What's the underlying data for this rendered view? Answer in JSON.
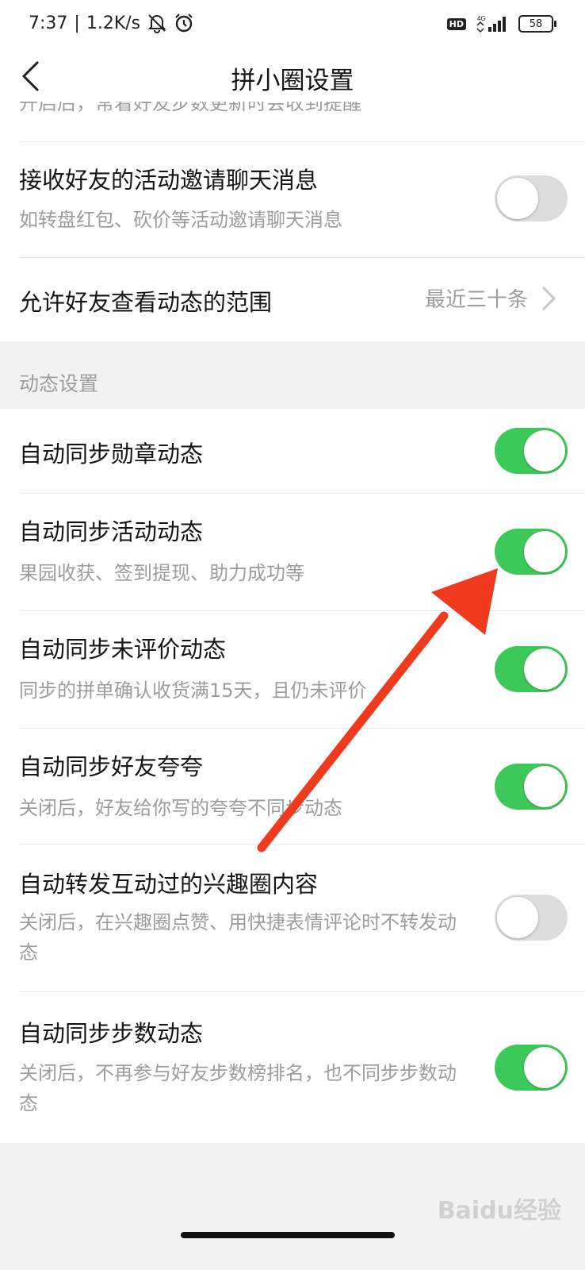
{
  "status_bar": {
    "time": "7:37",
    "speed": "1.2K/s",
    "network": "4G",
    "battery": "58",
    "icons": [
      "mute-bell-icon",
      "alarm-icon",
      "hd-icon",
      "signal-icon",
      "battery-icon"
    ]
  },
  "header": {
    "title": "拼小圈设置",
    "back_icon": "back-chevron-icon"
  },
  "partial_row": {
    "text": "开启后，常着好友步数更新时会收到提醒"
  },
  "group_top": [
    {
      "title": "接收好友的活动邀请聊天消息",
      "desc": "如转盘红包、砍价等活动邀请聊天消息",
      "toggle": false
    },
    {
      "title": "允许好友查看动态的范围",
      "value": "最近三十条",
      "chevron_icon": "chevron-right-icon"
    }
  ],
  "section": {
    "header": "动态设置"
  },
  "dynamic_settings": [
    {
      "title": "自动同步勋章动态",
      "desc": "",
      "toggle": true
    },
    {
      "title": "自动同步活动动态",
      "desc": "果园收获、签到提现、助力成功等",
      "toggle": true
    },
    {
      "title": "自动同步未评价动态",
      "desc": "同步的拼单确认收货满15天，且仍未评价",
      "toggle": true
    },
    {
      "title": "自动同步好友夸夸",
      "desc": "关闭后，好友给你写的夸夸不同步动态",
      "toggle": true
    },
    {
      "title": "自动转发互动过的兴趣圈内容",
      "desc": "关闭后，在兴趣圈点赞、用快捷表情评论时不转发动态",
      "toggle": false
    },
    {
      "title": "自动同步步数动态",
      "desc": "关闭后，不再参与好友步数榜排名，也不同步步数动态",
      "toggle": true
    }
  ],
  "watermark": "Baidu经验",
  "colors": {
    "toggle_on": "#3dc95a",
    "toggle_off": "#dcdcdc",
    "arrow": "#f03a1f"
  }
}
